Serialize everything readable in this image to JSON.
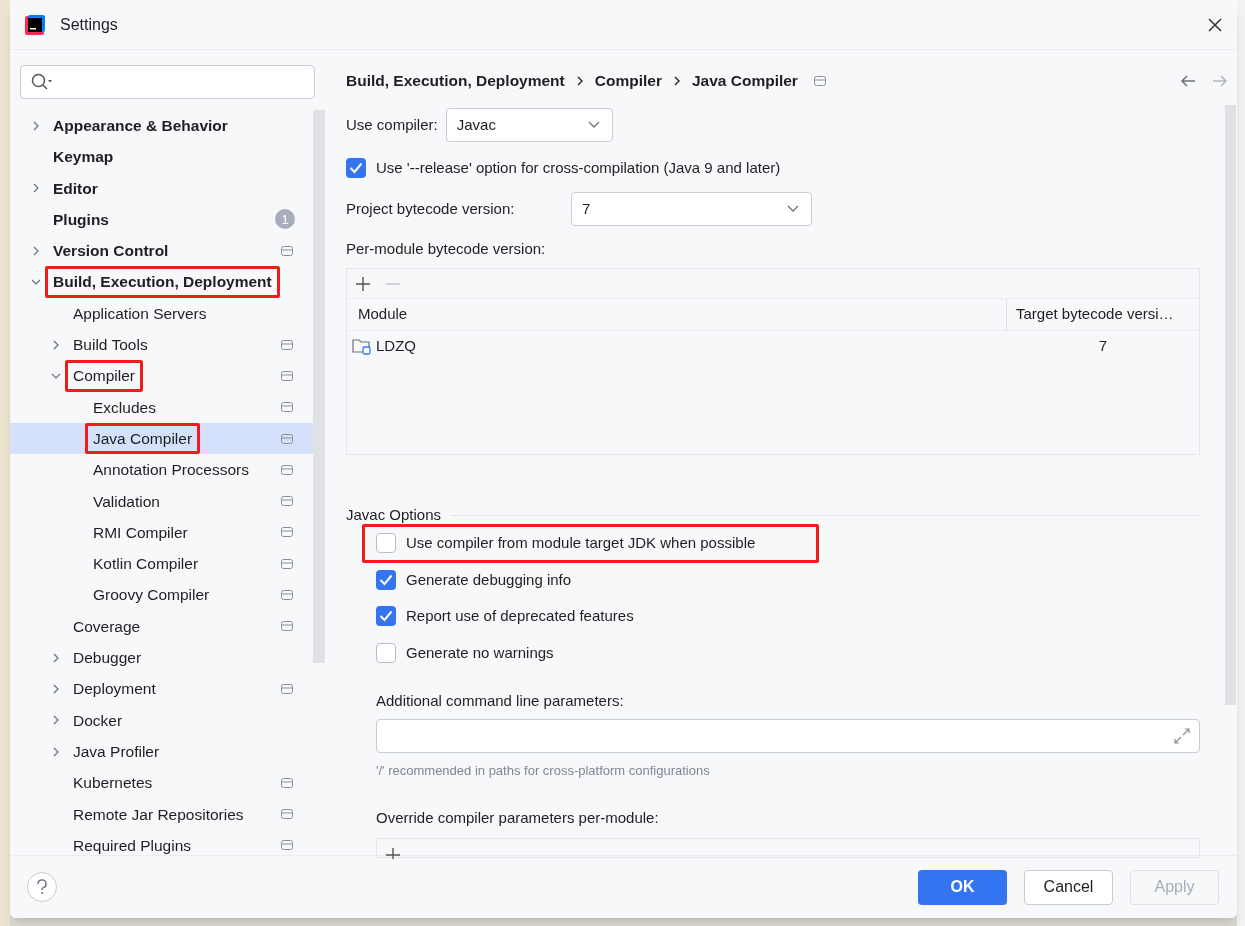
{
  "window": {
    "title": "Settings"
  },
  "tree": [
    {
      "label": "Appearance & Behavior",
      "expanded": false,
      "selected": false
    },
    {
      "label": "Keymap",
      "selected": false
    },
    {
      "label": "Editor",
      "expanded": false,
      "selected": false
    },
    {
      "label": "Plugins",
      "badge": "1",
      "selected": false
    },
    {
      "label": "Version Control",
      "expanded": false,
      "project_level": true,
      "selected": false
    },
    {
      "label": "Build, Execution, Deployment",
      "expanded": true,
      "selected": false,
      "highlighted": true,
      "children": [
        {
          "label": "Application Servers",
          "selected": false
        },
        {
          "label": "Build Tools",
          "expanded": false,
          "project_level": true,
          "selected": false
        },
        {
          "label": "Compiler",
          "expanded": true,
          "project_level": true,
          "selected": false,
          "highlighted": true,
          "children": [
            {
              "label": "Excludes",
              "project_level": true,
              "selected": false
            },
            {
              "label": "Java Compiler",
              "project_level": true,
              "selected": true,
              "highlighted": true
            },
            {
              "label": "Annotation Processors",
              "project_level": true,
              "selected": false
            },
            {
              "label": "Validation",
              "project_level": true,
              "selected": false
            },
            {
              "label": "RMI Compiler",
              "project_level": true,
              "selected": false
            },
            {
              "label": "Kotlin Compiler",
              "project_level": true,
              "selected": false
            },
            {
              "label": "Groovy Compiler",
              "project_level": true,
              "selected": false
            }
          ]
        },
        {
          "label": "Coverage",
          "project_level": true,
          "selected": false
        },
        {
          "label": "Debugger",
          "expanded": false,
          "selected": false
        },
        {
          "label": "Deployment",
          "expanded": false,
          "project_level": true,
          "selected": false
        },
        {
          "label": "Docker",
          "expanded": false,
          "selected": false
        },
        {
          "label": "Java Profiler",
          "expanded": false,
          "selected": false
        },
        {
          "label": "Kubernetes",
          "project_level": true,
          "selected": false
        },
        {
          "label": "Remote Jar Repositories",
          "project_level": true,
          "selected": false
        },
        {
          "label": "Required Plugins",
          "project_level": true,
          "selected": false
        }
      ]
    }
  ],
  "breadcrumb": [
    "Build, Execution, Deployment",
    "Compiler",
    "Java Compiler"
  ],
  "use_compiler": {
    "label": "Use compiler:",
    "value": "Javac"
  },
  "release_option": {
    "label": "Use '--release' option for cross-compilation (Java 9 and later)",
    "checked": true
  },
  "project_bytecode": {
    "label": "Project bytecode version:",
    "value": "7"
  },
  "per_module": {
    "label": "Per-module bytecode version:",
    "columns": [
      "Module",
      "Target bytecode versi…"
    ],
    "rows": [
      {
        "module": "LDZQ",
        "target": "7"
      }
    ]
  },
  "javac_options": {
    "title": "Javac Options",
    "options": [
      {
        "label": "Use compiler from module target JDK when possible",
        "checked": false,
        "highlighted": true
      },
      {
        "label": "Generate debugging info",
        "checked": true
      },
      {
        "label": "Report use of deprecated features",
        "checked": true
      },
      {
        "label": "Generate no warnings",
        "checked": false
      }
    ]
  },
  "additional_params": {
    "label": "Additional command line parameters:",
    "hint": "'/' recommended in paths for cross-platform configurations"
  },
  "override": {
    "label": "Override compiler parameters per-module:"
  },
  "buttons": [
    {
      "label": "OK",
      "kind": "primary"
    },
    {
      "label": "Cancel",
      "kind": "normal"
    },
    {
      "label": "Apply",
      "kind": "disabled"
    }
  ]
}
